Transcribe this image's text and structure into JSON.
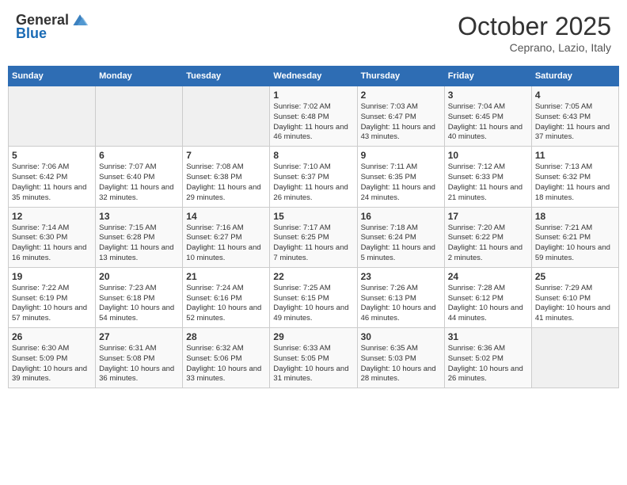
{
  "header": {
    "logo_general": "General",
    "logo_blue": "Blue",
    "month": "October 2025",
    "location": "Ceprano, Lazio, Italy"
  },
  "days_of_week": [
    "Sunday",
    "Monday",
    "Tuesday",
    "Wednesday",
    "Thursday",
    "Friday",
    "Saturday"
  ],
  "weeks": [
    [
      {
        "day": "",
        "content": ""
      },
      {
        "day": "",
        "content": ""
      },
      {
        "day": "",
        "content": ""
      },
      {
        "day": "1",
        "content": "Sunrise: 7:02 AM\nSunset: 6:48 PM\nDaylight: 11 hours and 46 minutes."
      },
      {
        "day": "2",
        "content": "Sunrise: 7:03 AM\nSunset: 6:47 PM\nDaylight: 11 hours and 43 minutes."
      },
      {
        "day": "3",
        "content": "Sunrise: 7:04 AM\nSunset: 6:45 PM\nDaylight: 11 hours and 40 minutes."
      },
      {
        "day": "4",
        "content": "Sunrise: 7:05 AM\nSunset: 6:43 PM\nDaylight: 11 hours and 37 minutes."
      }
    ],
    [
      {
        "day": "5",
        "content": "Sunrise: 7:06 AM\nSunset: 6:42 PM\nDaylight: 11 hours and 35 minutes."
      },
      {
        "day": "6",
        "content": "Sunrise: 7:07 AM\nSunset: 6:40 PM\nDaylight: 11 hours and 32 minutes."
      },
      {
        "day": "7",
        "content": "Sunrise: 7:08 AM\nSunset: 6:38 PM\nDaylight: 11 hours and 29 minutes."
      },
      {
        "day": "8",
        "content": "Sunrise: 7:10 AM\nSunset: 6:37 PM\nDaylight: 11 hours and 26 minutes."
      },
      {
        "day": "9",
        "content": "Sunrise: 7:11 AM\nSunset: 6:35 PM\nDaylight: 11 hours and 24 minutes."
      },
      {
        "day": "10",
        "content": "Sunrise: 7:12 AM\nSunset: 6:33 PM\nDaylight: 11 hours and 21 minutes."
      },
      {
        "day": "11",
        "content": "Sunrise: 7:13 AM\nSunset: 6:32 PM\nDaylight: 11 hours and 18 minutes."
      }
    ],
    [
      {
        "day": "12",
        "content": "Sunrise: 7:14 AM\nSunset: 6:30 PM\nDaylight: 11 hours and 16 minutes."
      },
      {
        "day": "13",
        "content": "Sunrise: 7:15 AM\nSunset: 6:28 PM\nDaylight: 11 hours and 13 minutes."
      },
      {
        "day": "14",
        "content": "Sunrise: 7:16 AM\nSunset: 6:27 PM\nDaylight: 11 hours and 10 minutes."
      },
      {
        "day": "15",
        "content": "Sunrise: 7:17 AM\nSunset: 6:25 PM\nDaylight: 11 hours and 7 minutes."
      },
      {
        "day": "16",
        "content": "Sunrise: 7:18 AM\nSunset: 6:24 PM\nDaylight: 11 hours and 5 minutes."
      },
      {
        "day": "17",
        "content": "Sunrise: 7:20 AM\nSunset: 6:22 PM\nDaylight: 11 hours and 2 minutes."
      },
      {
        "day": "18",
        "content": "Sunrise: 7:21 AM\nSunset: 6:21 PM\nDaylight: 10 hours and 59 minutes."
      }
    ],
    [
      {
        "day": "19",
        "content": "Sunrise: 7:22 AM\nSunset: 6:19 PM\nDaylight: 10 hours and 57 minutes."
      },
      {
        "day": "20",
        "content": "Sunrise: 7:23 AM\nSunset: 6:18 PM\nDaylight: 10 hours and 54 minutes."
      },
      {
        "day": "21",
        "content": "Sunrise: 7:24 AM\nSunset: 6:16 PM\nDaylight: 10 hours and 52 minutes."
      },
      {
        "day": "22",
        "content": "Sunrise: 7:25 AM\nSunset: 6:15 PM\nDaylight: 10 hours and 49 minutes."
      },
      {
        "day": "23",
        "content": "Sunrise: 7:26 AM\nSunset: 6:13 PM\nDaylight: 10 hours and 46 minutes."
      },
      {
        "day": "24",
        "content": "Sunrise: 7:28 AM\nSunset: 6:12 PM\nDaylight: 10 hours and 44 minutes."
      },
      {
        "day": "25",
        "content": "Sunrise: 7:29 AM\nSunset: 6:10 PM\nDaylight: 10 hours and 41 minutes."
      }
    ],
    [
      {
        "day": "26",
        "content": "Sunrise: 6:30 AM\nSunset: 5:09 PM\nDaylight: 10 hours and 39 minutes."
      },
      {
        "day": "27",
        "content": "Sunrise: 6:31 AM\nSunset: 5:08 PM\nDaylight: 10 hours and 36 minutes."
      },
      {
        "day": "28",
        "content": "Sunrise: 6:32 AM\nSunset: 5:06 PM\nDaylight: 10 hours and 33 minutes."
      },
      {
        "day": "29",
        "content": "Sunrise: 6:33 AM\nSunset: 5:05 PM\nDaylight: 10 hours and 31 minutes."
      },
      {
        "day": "30",
        "content": "Sunrise: 6:35 AM\nSunset: 5:03 PM\nDaylight: 10 hours and 28 minutes."
      },
      {
        "day": "31",
        "content": "Sunrise: 6:36 AM\nSunset: 5:02 PM\nDaylight: 10 hours and 26 minutes."
      },
      {
        "day": "",
        "content": ""
      }
    ]
  ]
}
